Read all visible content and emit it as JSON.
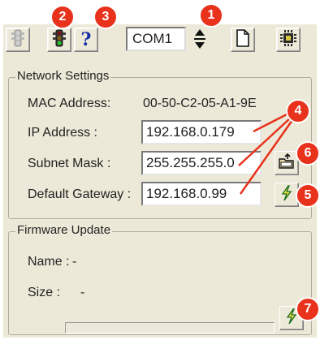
{
  "toolbar": {
    "port_value": "COM1",
    "buttons": [
      {
        "icon": "traffic-light-gray-icon"
      },
      {
        "icon": "traffic-light-icon"
      },
      {
        "icon": "help-icon",
        "glyph": "?"
      },
      {
        "icon": "new-document-icon"
      },
      {
        "icon": "chip-icon"
      }
    ]
  },
  "network_settings": {
    "title": "Network Settings",
    "mac_label": "MAC Address:",
    "mac_value": "00-50-C2-05-A1-9E",
    "ip_label": "IP Address :",
    "ip_value": "192.168.0.179",
    "subnet_label": "Subnet Mask :",
    "subnet_value": "255.255.255.0",
    "gateway_label": "Default Gateway :",
    "gateway_value": "192.168.0.99"
  },
  "firmware_update": {
    "title": "Firmware Update",
    "name_label": "Name :",
    "name_value": "-",
    "size_label": "Size :",
    "size_value": "-",
    "progress": 0
  },
  "callouts": [
    "1",
    "2",
    "3",
    "4",
    "5",
    "6",
    "7"
  ],
  "colors": {
    "panel": "#ece9d8",
    "callout": "#e8321c",
    "callout_line": "#e8321c"
  }
}
